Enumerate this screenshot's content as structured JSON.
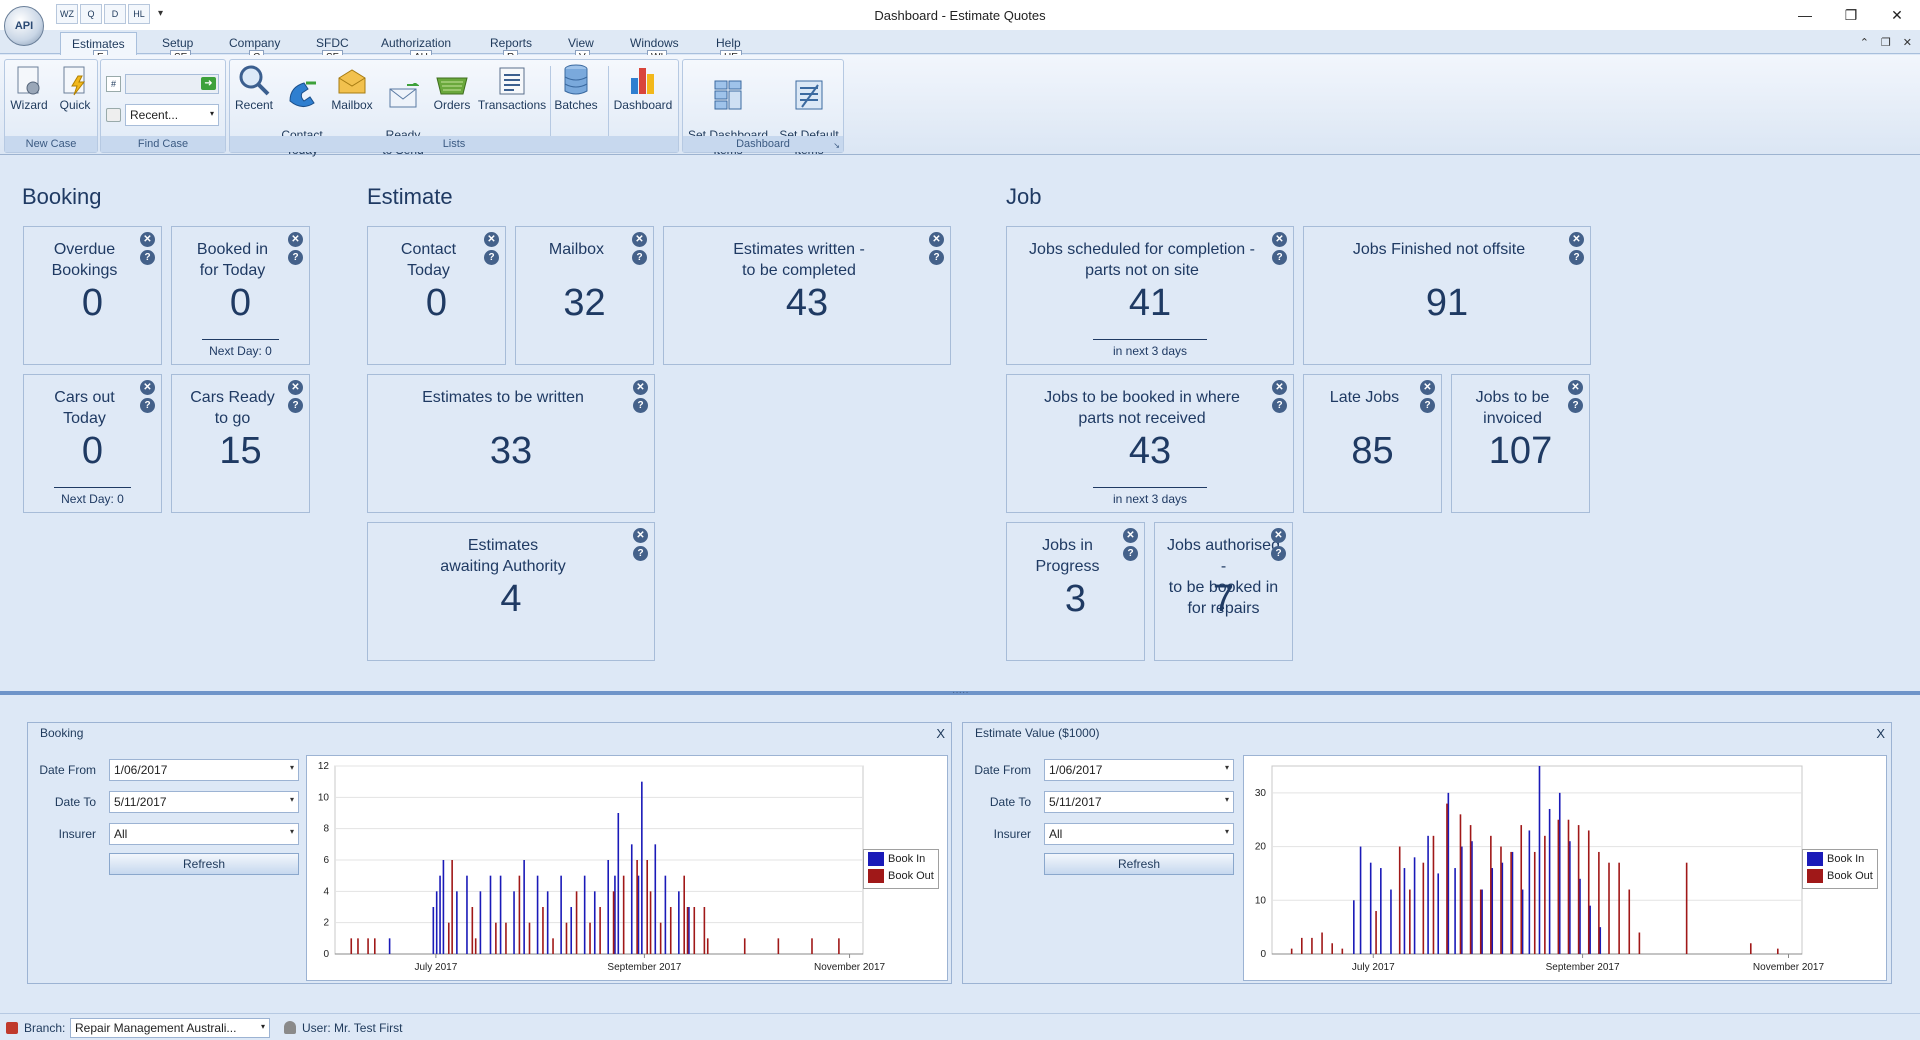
{
  "app": {
    "orb_label": "API",
    "window_title": "Dashboard - Estimate Quotes",
    "quick_access": [
      "WZ",
      "Q",
      "D",
      "HL"
    ],
    "window_controls": {
      "minimize": "—",
      "restore": "❐",
      "close": "✕"
    },
    "mini_controls": [
      "⌃",
      "❐",
      "✕"
    ]
  },
  "ribbon": {
    "tabs": [
      {
        "label": "Estimates",
        "keytip": "E",
        "active": true
      },
      {
        "label": "Setup",
        "keytip": "SE"
      },
      {
        "label": "Company",
        "keytip": "C"
      },
      {
        "label": "SFDC",
        "keytip": "SF"
      },
      {
        "label": "Authorization",
        "keytip": "AU"
      },
      {
        "label": "Reports",
        "keytip": "R"
      },
      {
        "label": "View",
        "keytip": "V"
      },
      {
        "label": "Windows",
        "keytip": "WI"
      },
      {
        "label": "Help",
        "keytip": "HE"
      }
    ],
    "groups": {
      "new_case": {
        "label": "New Case",
        "buttons": [
          "Wizard",
          "Quick"
        ]
      },
      "find_case": {
        "label": "Find Case",
        "search_placeholder": "#",
        "recent_value": "Recent..."
      },
      "lists": {
        "label": "Lists",
        "buttons": [
          "Recent",
          "Contact\nToday",
          "Mailbox",
          "Ready\nto Send",
          "Orders",
          "Transactions",
          "Batches",
          "Dashboard"
        ]
      },
      "dashboard": {
        "label": "Dashboard",
        "buttons": [
          "Set Dashboard\nItems",
          "Set Default\nItems"
        ]
      }
    }
  },
  "dashboard": {
    "sections": {
      "booking": "Booking",
      "estimate": "Estimate",
      "job": "Job"
    },
    "tiles": [
      {
        "id": "overdue-bookings",
        "title": "Overdue\nBookings",
        "value": "0",
        "footer": ""
      },
      {
        "id": "booked-in-today",
        "title": "Booked in\nfor Today",
        "value": "0",
        "footer": "Next Day: 0"
      },
      {
        "id": "cars-out-today",
        "title": "Cars out\nToday",
        "value": "0",
        "footer": "Next Day: 0"
      },
      {
        "id": "cars-ready",
        "title": "Cars Ready\nto go",
        "value": "15",
        "footer": ""
      },
      {
        "id": "contact-today",
        "title": "Contact\nToday",
        "value": "0",
        "footer": ""
      },
      {
        "id": "mailbox",
        "title": "Mailbox",
        "value": "32",
        "footer": ""
      },
      {
        "id": "estimates-written",
        "title": "Estimates written -\nto be completed",
        "value": "43",
        "footer": ""
      },
      {
        "id": "estimates-to-write",
        "title": "Estimates to be written",
        "value": "33",
        "footer": ""
      },
      {
        "id": "estimates-authority",
        "title": "Estimates\nawaiting Authority",
        "value": "4",
        "footer": ""
      },
      {
        "id": "jobs-scheduled",
        "title": "Jobs scheduled for completion -\nparts not on site",
        "value": "41",
        "footer": "in next 3 days"
      },
      {
        "id": "jobs-finished",
        "title": "Jobs Finished not offsite",
        "value": "91",
        "footer": ""
      },
      {
        "id": "jobs-booked-parts",
        "title": "Jobs  to be booked in where\nparts not received",
        "value": "43",
        "footer": "in next 3 days"
      },
      {
        "id": "late-jobs",
        "title": "Late Jobs",
        "value": "85",
        "footer": ""
      },
      {
        "id": "jobs-invoiced",
        "title": "Jobs to be\ninvoiced",
        "value": "107",
        "footer": ""
      },
      {
        "id": "jobs-in-progress",
        "title": "Jobs in\nProgress",
        "value": "3",
        "footer": ""
      },
      {
        "id": "jobs-authorised",
        "title": "Jobs authorised\n-\nto be booked in\nfor repairs",
        "value": "7",
        "footer": ""
      }
    ]
  },
  "panels": [
    {
      "title": "Booking",
      "close": "X",
      "labels": {
        "date_from": "Date From",
        "date_to": "Date To",
        "insurer": "Insurer"
      },
      "date_from": "1/06/2017",
      "date_to": "5/11/2017",
      "insurer": "All",
      "refresh": "Refresh",
      "legend": [
        "Book In",
        "Book Out"
      ]
    },
    {
      "title": "Estimate Value ($1000)",
      "close": "X",
      "labels": {
        "date_from": "Date From",
        "date_to": "Date To",
        "insurer": "Insurer"
      },
      "date_from": "1/06/2017",
      "date_to": "5/11/2017",
      "insurer": "All",
      "refresh": "Refresh",
      "legend": [
        "Book In",
        "Book Out"
      ]
    }
  ],
  "chart_data": [
    {
      "type": "bar",
      "title": "Booking",
      "x_axis": "date",
      "x_range": [
        "2017-06-01",
        "2017-11-05"
      ],
      "x_tick_labels": [
        "July 2017",
        "September 2017",
        "November 2017"
      ],
      "ylim": [
        0,
        12
      ],
      "y_ticks": [
        0,
        2,
        4,
        6,
        8,
        10,
        12
      ],
      "grid": true,
      "legend_position": "right",
      "colors": {
        "Book In": "#1a1ab8",
        "Book Out": "#a01818"
      },
      "series": [
        {
          "name": "Book In",
          "points": [
            [
              "2017-06-17",
              1
            ],
            [
              "2017-06-30",
              3
            ],
            [
              "2017-07-01",
              4
            ],
            [
              "2017-07-02",
              5
            ],
            [
              "2017-07-03",
              6
            ],
            [
              "2017-07-07",
              4
            ],
            [
              "2017-07-10",
              5
            ],
            [
              "2017-07-14",
              4
            ],
            [
              "2017-07-17",
              5
            ],
            [
              "2017-07-20",
              5
            ],
            [
              "2017-07-24",
              4
            ],
            [
              "2017-07-27",
              6
            ],
            [
              "2017-07-31",
              5
            ],
            [
              "2017-08-03",
              4
            ],
            [
              "2017-08-07",
              5
            ],
            [
              "2017-08-10",
              3
            ],
            [
              "2017-08-14",
              5
            ],
            [
              "2017-08-17",
              4
            ],
            [
              "2017-08-21",
              6
            ],
            [
              "2017-08-23",
              5
            ],
            [
              "2017-08-24",
              9
            ],
            [
              "2017-08-28",
              7
            ],
            [
              "2017-08-30",
              5
            ],
            [
              "2017-08-31",
              11
            ],
            [
              "2017-09-04",
              7
            ],
            [
              "2017-09-07",
              5
            ],
            [
              "2017-09-11",
              4
            ],
            [
              "2017-09-14",
              3
            ]
          ]
        },
        {
          "name": "Book Out",
          "points": [
            [
              "2017-06-05",
              1
            ],
            [
              "2017-06-07",
              1
            ],
            [
              "2017-06-10",
              1
            ],
            [
              "2017-06-12",
              1
            ],
            [
              "2017-07-04",
              2
            ],
            [
              "2017-07-05",
              6
            ],
            [
              "2017-07-11",
              3
            ],
            [
              "2017-07-12",
              1
            ],
            [
              "2017-07-18",
              2
            ],
            [
              "2017-07-21",
              2
            ],
            [
              "2017-07-25",
              5
            ],
            [
              "2017-07-28",
              2
            ],
            [
              "2017-08-01",
              3
            ],
            [
              "2017-08-04",
              1
            ],
            [
              "2017-08-08",
              2
            ],
            [
              "2017-08-11",
              4
            ],
            [
              "2017-08-15",
              2
            ],
            [
              "2017-08-18",
              3
            ],
            [
              "2017-08-22",
              4
            ],
            [
              "2017-08-25",
              5
            ],
            [
              "2017-08-29",
              6
            ],
            [
              "2017-09-01",
              6
            ],
            [
              "2017-09-02",
              4
            ],
            [
              "2017-09-05",
              2
            ],
            [
              "2017-09-08",
              3
            ],
            [
              "2017-09-12",
              5
            ],
            [
              "2017-09-13",
              3
            ],
            [
              "2017-09-15",
              3
            ],
            [
              "2017-09-18",
              3
            ],
            [
              "2017-09-19",
              1
            ],
            [
              "2017-09-30",
              1
            ],
            [
              "2017-10-10",
              1
            ],
            [
              "2017-10-20",
              1
            ],
            [
              "2017-10-28",
              1
            ]
          ]
        }
      ]
    },
    {
      "type": "bar",
      "title": "Estimate Value ($1000)",
      "x_axis": "date",
      "x_range": [
        "2017-06-01",
        "2017-11-05"
      ],
      "x_tick_labels": [
        "July 2017",
        "September 2017",
        "November 2017"
      ],
      "ylim": [
        0,
        35
      ],
      "y_ticks": [
        0,
        10,
        20,
        30
      ],
      "grid": true,
      "legend_position": "right",
      "colors": {
        "Book In": "#1a1ab8",
        "Book Out": "#a01818"
      },
      "series": [
        {
          "name": "Book In",
          "points": [
            [
              "2017-06-25",
              10
            ],
            [
              "2017-06-27",
              20
            ],
            [
              "2017-06-30",
              17
            ],
            [
              "2017-07-03",
              16
            ],
            [
              "2017-07-06",
              12
            ],
            [
              "2017-07-10",
              16
            ],
            [
              "2017-07-13",
              18
            ],
            [
              "2017-07-17",
              22
            ],
            [
              "2017-07-20",
              15
            ],
            [
              "2017-07-23",
              30
            ],
            [
              "2017-07-25",
              16
            ],
            [
              "2017-07-27",
              20
            ],
            [
              "2017-07-30",
              21
            ],
            [
              "2017-08-02",
              12
            ],
            [
              "2017-08-05",
              16
            ],
            [
              "2017-08-08",
              17
            ],
            [
              "2017-08-11",
              19
            ],
            [
              "2017-08-14",
              12
            ],
            [
              "2017-08-16",
              23
            ],
            [
              "2017-08-19",
              35
            ],
            [
              "2017-08-22",
              27
            ],
            [
              "2017-08-25",
              30
            ],
            [
              "2017-08-28",
              21
            ],
            [
              "2017-08-31",
              14
            ],
            [
              "2017-09-03",
              9
            ],
            [
              "2017-09-06",
              5
            ]
          ]
        },
        {
          "name": "Book Out",
          "points": [
            [
              "2017-06-06",
              1
            ],
            [
              "2017-06-09",
              3
            ],
            [
              "2017-06-12",
              3
            ],
            [
              "2017-06-15",
              4
            ],
            [
              "2017-06-18",
              2
            ],
            [
              "2017-06-21",
              1
            ],
            [
              "2017-07-01",
              8
            ],
            [
              "2017-07-08",
              20
            ],
            [
              "2017-07-11",
              12
            ],
            [
              "2017-07-15",
              17
            ],
            [
              "2017-07-18",
              22
            ],
            [
              "2017-07-22",
              28
            ],
            [
              "2017-07-26",
              26
            ],
            [
              "2017-07-29",
              24
            ],
            [
              "2017-08-01",
              12
            ],
            [
              "2017-08-04",
              22
            ],
            [
              "2017-08-07",
              20
            ],
            [
              "2017-08-10",
              19
            ],
            [
              "2017-08-13",
              24
            ],
            [
              "2017-08-17",
              19
            ],
            [
              "2017-08-20",
              22
            ],
            [
              "2017-08-24",
              25
            ],
            [
              "2017-08-27",
              25
            ],
            [
              "2017-08-30",
              24
            ],
            [
              "2017-09-02",
              23
            ],
            [
              "2017-09-05",
              19
            ],
            [
              "2017-09-08",
              17
            ],
            [
              "2017-09-11",
              17
            ],
            [
              "2017-09-14",
              12
            ],
            [
              "2017-09-17",
              4
            ],
            [
              "2017-10-01",
              17
            ],
            [
              "2017-10-20",
              2
            ],
            [
              "2017-10-28",
              1
            ]
          ]
        }
      ]
    }
  ],
  "statusbar": {
    "branch_label": "Branch:",
    "branch_value": "Repair Management Australi...",
    "user": "User: Mr. Test  First"
  }
}
